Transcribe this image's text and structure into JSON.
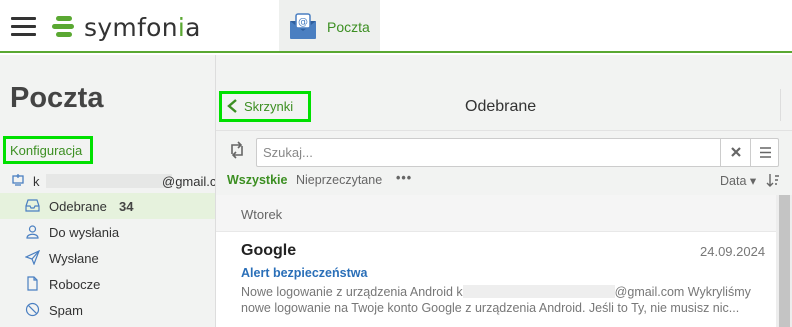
{
  "header": {
    "logo_text_prefix": "symfon",
    "logo_text_accent": "i",
    "logo_text_suffix": "a",
    "app_tab_label": "Poczta"
  },
  "sidebar": {
    "title": "Poczta",
    "config_link": "Konfiguracja",
    "account_prefix": "k",
    "account_domain": "@gmail.c",
    "folders": [
      {
        "icon": "inbox-icon",
        "label": "Odebrane",
        "count": "34"
      },
      {
        "icon": "outbox-icon",
        "label": "Do wysłania",
        "count": ""
      },
      {
        "icon": "send-icon",
        "label": "Wysłane",
        "count": ""
      },
      {
        "icon": "draft-icon",
        "label": "Robocze",
        "count": ""
      },
      {
        "icon": "spam-icon",
        "label": "Spam",
        "count": ""
      }
    ]
  },
  "main": {
    "back_label": "Skrzynki",
    "title": "Odebrane",
    "search_placeholder": "Szukaj...",
    "filters": {
      "all": "Wszystkie",
      "unread": "Nieprzeczytane",
      "more": "•••"
    },
    "sort_label": "Data ▾",
    "day_header": "Wtorek",
    "messages": [
      {
        "sender": "Google",
        "date": "24.09.2024",
        "subject": "Alert bezpieczeństwa",
        "preview_a": "Nowe logowanie z urządzenia Android k",
        "preview_b": "@gmail.com Wykryliśmy",
        "preview_c": "nowe logowanie na Twoje konto Google z urządzenia Android. Jeśli to Ty, nie musisz nic..."
      }
    ]
  },
  "colors": {
    "accent": "#5aa832",
    "link": "#2a6fb8",
    "highlight_box": "#00e000"
  }
}
